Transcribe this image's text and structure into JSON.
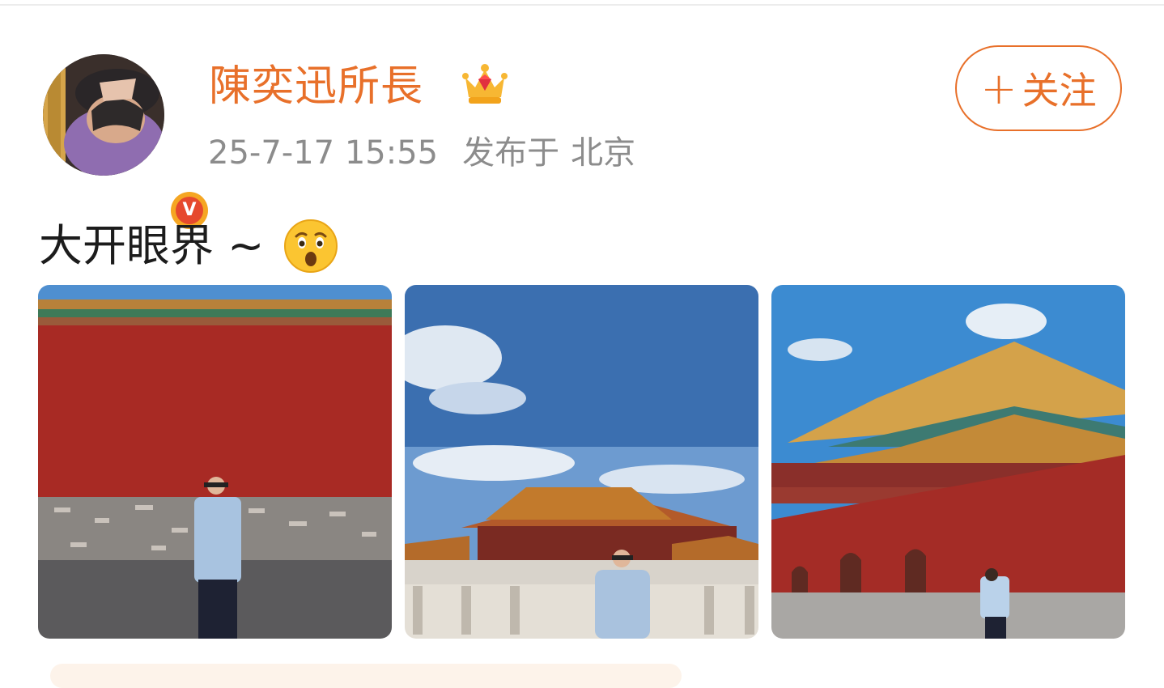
{
  "post": {
    "user": {
      "name": "陳奕迅所長",
      "verified_badge": "v-badge-icon",
      "member_icon": "crown-icon"
    },
    "meta": {
      "date": "25-7-17 15:55",
      "location_label": "发布于",
      "location": "北京"
    },
    "follow": {
      "plus": "+",
      "label": "关注"
    },
    "text": "大开眼界 ~",
    "emoji": "surprised-face-icon",
    "images": [
      "red-wall-photo",
      "palace-hall-photo",
      "meridian-gate-photo"
    ]
  },
  "colors": {
    "accent": "#e8702a",
    "meta_text": "#8c8c8c",
    "body_text": "#1c1c1c"
  }
}
